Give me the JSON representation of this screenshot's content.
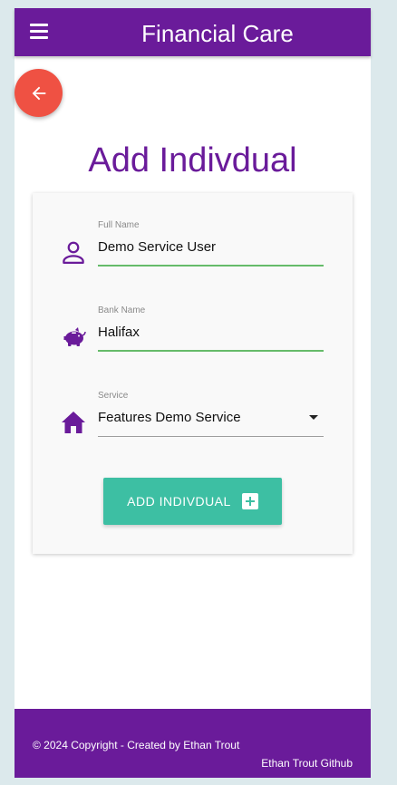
{
  "navbar": {
    "title": "Financial Care",
    "menu_icon": "hamburger-menu-icon"
  },
  "back_button": {
    "icon": "arrow-left-icon"
  },
  "page_title": "Add Indivdual",
  "form": {
    "full_name": {
      "label": "Full Name",
      "value": "Demo Service User",
      "icon": "person-icon"
    },
    "bank_name": {
      "label": "Bank Name",
      "value": "Halifax",
      "icon": "piggy-bank-icon"
    },
    "service": {
      "label": "Service",
      "value": "Features Demo Service",
      "icon": "home-icon"
    },
    "submit_label": "ADD INDIVDUAL",
    "submit_icon": "plus-box-icon"
  },
  "footer": {
    "copyright": "© 2024 Copyright - Created by Ethan Trout",
    "github_link": "Ethan Trout Github"
  },
  "colors": {
    "primary": "#6a1b9a",
    "accent_button": "#3dbfa3",
    "back_button": "#ef5143",
    "input_underline_active": "#66bb6a",
    "page_background": "#dce9ec"
  }
}
